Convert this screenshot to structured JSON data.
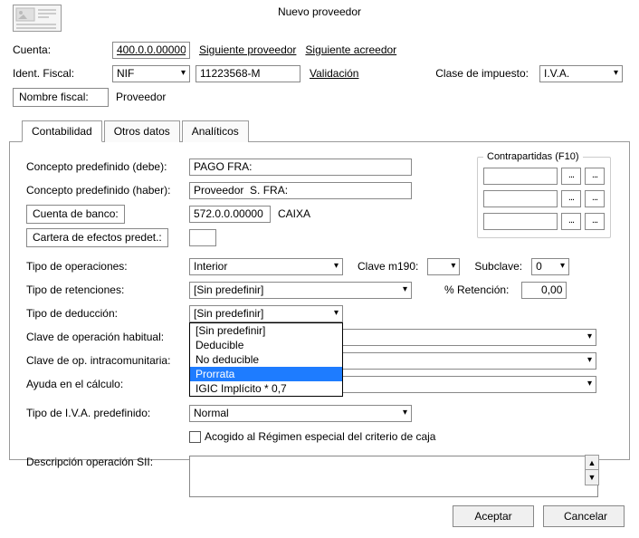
{
  "title": "Nuevo proveedor",
  "header": {
    "cuenta_label": "Cuenta:",
    "cuenta_value": "400.0.0.00000",
    "siguiente_proveedor": "Siguiente proveedor",
    "siguiente_acreedor": "Siguiente acreedor",
    "ident_label": "Ident. Fiscal:",
    "ident_type": "NIF",
    "ident_value": "11223568-M",
    "validacion": "Validación",
    "clase_impuesto_label": "Clase de impuesto:",
    "clase_impuesto_value": "I.V.A.",
    "nombre_fiscal_label": "Nombre fiscal:",
    "nombre_fiscal_value": "Proveedor"
  },
  "tabs": {
    "contabilidad": "Contabilidad",
    "otros": "Otros datos",
    "analiticos": "Analíticos"
  },
  "panel": {
    "concepto_debe_label": "Concepto predefinido (debe):",
    "concepto_debe_value": "PAGO FRA:",
    "concepto_haber_label": "Concepto predefinido (haber):",
    "concepto_haber_value": "Proveedor  S. FRA:",
    "cuenta_banco_label": "Cuenta de banco:",
    "cuenta_banco_value": "572.0.0.00000",
    "cuenta_banco_name": "CAIXA",
    "cartera_label": "Cartera de efectos predet.:",
    "cartera_value": "",
    "contrapartidas_title": "Contrapartidas (F10)",
    "mini_dots": "...",
    "tipo_operaciones_label": "Tipo de operaciones:",
    "tipo_operaciones_value": "Interior",
    "clave_m190_label": "Clave m190:",
    "clave_m190_value": "",
    "subclave_label": "Subclave:",
    "subclave_value": "0",
    "tipo_retenciones_label": "Tipo de retenciones:",
    "tipo_retenciones_value": "[Sin predefinir]",
    "pct_retencion_label": "% Retención:",
    "pct_retencion_value": "0,00",
    "tipo_deduccion_label": "Tipo de deducción:",
    "tipo_deduccion_value": "[Sin predefinir]",
    "dd_options": [
      "[Sin predefinir]",
      "Deducible",
      "No deducible",
      "Prorrata",
      "IGIC Implícito * 0,7"
    ],
    "dd_hover_index": 3,
    "clave_op_habitual_label": "Clave de operación habitual:",
    "clave_op_habitual_value": "",
    "clave_intra_label": "Clave de op. intracomunitaria:",
    "clave_intra_value": "",
    "ayuda_calculo_label": "Ayuda en el cálculo:",
    "ayuda_calculo_value": "",
    "tipo_iva_label": "Tipo de I.V.A. predefinido:",
    "tipo_iva_value": "Normal",
    "acogido_label": "Acogido al Régimen especial del criterio de caja",
    "descripcion_sii_label": "Descripción operación SII:"
  },
  "footer": {
    "aceptar": "Aceptar",
    "cancelar": "Cancelar"
  }
}
